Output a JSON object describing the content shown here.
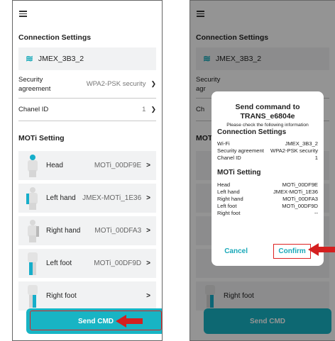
{
  "left": {
    "connection_title": "Connection Settings",
    "wifi_name": "JMEX_3B3_2",
    "security_label": "Security agreement",
    "security_value": "WPA2-PSK security",
    "channel_label": "Chanel ID",
    "channel_value": "1",
    "moti_title": "MOTi Setting",
    "moti_items": [
      {
        "name": "Head",
        "value": "MOTi_00DF9E"
      },
      {
        "name": "Left hand",
        "value": "JMEX-MOTi_1E36"
      },
      {
        "name": "Right hand",
        "value": "MOTi_00DFA3"
      },
      {
        "name": "Left foot",
        "value": "MOTi_00DF9D"
      },
      {
        "name": "Right foot",
        "value": ""
      }
    ],
    "send_label": "Send CMD"
  },
  "right": {
    "connection_title": "Connection Settings",
    "wifi_name": "JMEX_3B3_2",
    "security_label_1": "Security",
    "security_label_2": "agr",
    "channel_label": "Ch",
    "moti_title": "MOTi",
    "right_foot": "Right foot",
    "send_label": "Send CMD"
  },
  "dialog": {
    "title_line1": "Send command to",
    "title_line2": "TRANS_e6804e",
    "note": "Please check the following information",
    "connection_title": "Connection Settings",
    "rows": [
      {
        "k": "Wi-Fi",
        "v": "JMEX_3B3_2"
      },
      {
        "k": "Security agreement",
        "v": "WPA2-PSK security"
      },
      {
        "k": "Chanel ID",
        "v": "1"
      }
    ],
    "moti_title": "MOTi Setting",
    "moti_rows": [
      {
        "k": "Head",
        "v": "MOTi_00DF9E"
      },
      {
        "k": "Left hand",
        "v": "JMEX-MOTi_1E36"
      },
      {
        "k": "Right hand",
        "v": "MOTi_00DFA3"
      },
      {
        "k": "Left foot",
        "v": "MOTi_00DF9D"
      },
      {
        "k": "Right foot",
        "v": "--"
      }
    ],
    "cancel_label": "Cancel",
    "confirm_label": "Confirm"
  },
  "colors": {
    "accent": "#18b4c4",
    "highlight": "#d22222"
  }
}
